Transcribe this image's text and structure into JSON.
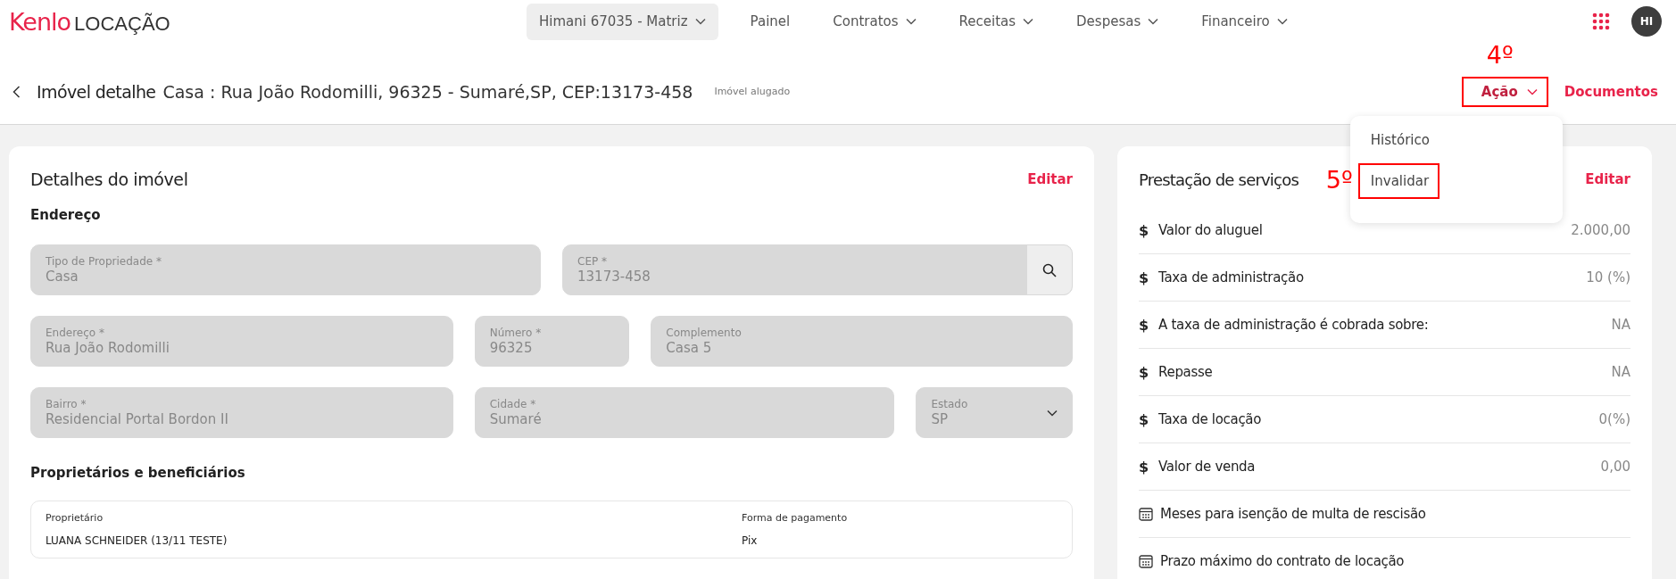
{
  "header": {
    "logo_brand": "Kenlo",
    "logo_product": "LOCAÇÃO",
    "branch": {
      "label": "Himani 67035 - Matriz",
      "dropdown": true
    },
    "nav": [
      {
        "label": "Painel",
        "dropdown": false
      },
      {
        "label": "Contratos",
        "dropdown": true
      },
      {
        "label": "Receitas",
        "dropdown": true
      },
      {
        "label": "Despesas",
        "dropdown": true
      },
      {
        "label": "Financeiro",
        "dropdown": true
      }
    ],
    "avatar": "HI"
  },
  "page_header": {
    "title": "Imóvel detalhe",
    "subtitle": "Casa : Rua João Rodomilli, 96325 - Sumaré,SP, CEP:13173-458",
    "status": "Imóvel alugado",
    "action_button": {
      "label": "Ação",
      "annotation": "4º"
    },
    "documents_link": "Documentos",
    "action_menu": {
      "expanded": true,
      "items": [
        {
          "label": "Histórico"
        },
        {
          "label": "Invalidar",
          "annotation": "5º"
        }
      ]
    }
  },
  "property_card": {
    "title": "Detalhes do imóvel",
    "edit": "Editar",
    "address_heading": "Endereço",
    "field_rows": [
      [
        {
          "label": "Tipo de Propriedade *",
          "value": "Casa",
          "kind": "text",
          "disabled": true
        },
        {
          "label": "CEP *",
          "value": "13173-458",
          "kind": "search",
          "disabled": true
        }
      ],
      [
        {
          "label": "Endereço *",
          "value": "Rua João Rodomilli",
          "kind": "text",
          "disabled": true
        },
        {
          "label": "Número *",
          "value": "96325",
          "kind": "text",
          "disabled": true
        },
        {
          "label": "Complemento",
          "value": "Casa 5",
          "kind": "text",
          "disabled": true
        }
      ],
      [
        {
          "label": "Bairro *",
          "value": "Residencial Portal Bordon II",
          "kind": "text",
          "disabled": true
        },
        {
          "label": "Cidade *",
          "value": "Sumaré",
          "kind": "text",
          "disabled": true
        },
        {
          "label": "Estado",
          "value": "SP",
          "kind": "select",
          "disabled": true
        }
      ]
    ],
    "owners_heading": "Proprietários e beneficiários",
    "owners_table": {
      "columns": [
        "Proprietário",
        "Forma de pagamento"
      ],
      "rows": [
        [
          "LUANA SCHNEIDER (13/11 TESTE)",
          "Pix"
        ]
      ]
    }
  },
  "services_card": {
    "title": "Prestação de serviços",
    "edit": "Editar",
    "rows": [
      {
        "kind": "money",
        "icon": "$",
        "label": "Valor do aluguel",
        "value": "2.000,00"
      },
      {
        "kind": "money",
        "icon": "$",
        "label": "Taxa de administração",
        "value": "10 (%)"
      },
      {
        "kind": "money",
        "icon": "$",
        "label": "A taxa de administração é cobrada sobre:",
        "value": "NA"
      },
      {
        "kind": "money",
        "icon": "$",
        "label": "Repasse",
        "value": "NA"
      },
      {
        "kind": "money",
        "icon": "$",
        "label": "Taxa de locação",
        "value": "0(%)"
      },
      {
        "kind": "money",
        "icon": "$",
        "label": "Valor de venda",
        "value": "0,00"
      },
      {
        "kind": "calendar",
        "label": "Meses para isenção de multa de rescisão"
      },
      {
        "kind": "calendar",
        "label": "Prazo máximo do contrato de locação"
      }
    ]
  }
}
